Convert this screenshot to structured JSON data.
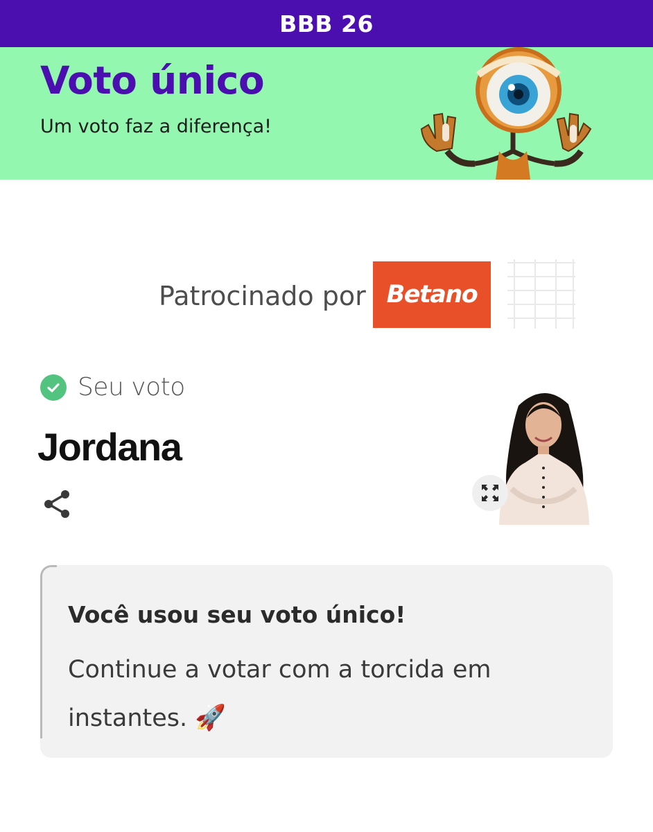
{
  "header": {
    "title": "BBB 26"
  },
  "hero": {
    "title": "Voto único",
    "subtitle": "Um voto faz a diferença!",
    "mascot_icon": "big-brother-eye-robot"
  },
  "sponsor": {
    "label": "Patrocinado por",
    "brand": "Betano",
    "brand_color": "#e8502a"
  },
  "vote": {
    "status_label": "Seu voto",
    "status_icon": "check-circle-icon",
    "candidate": "Jordana",
    "share_icon": "share-icon",
    "expand_icon": "expand-icon"
  },
  "notice": {
    "title": "Você usou seu voto único!",
    "body": "Continue a votar com a torcida em instantes.",
    "emoji": "🚀"
  },
  "colors": {
    "primary": "#4a0fae",
    "hero_bg": "#93f7b0",
    "success": "#52c47f"
  }
}
